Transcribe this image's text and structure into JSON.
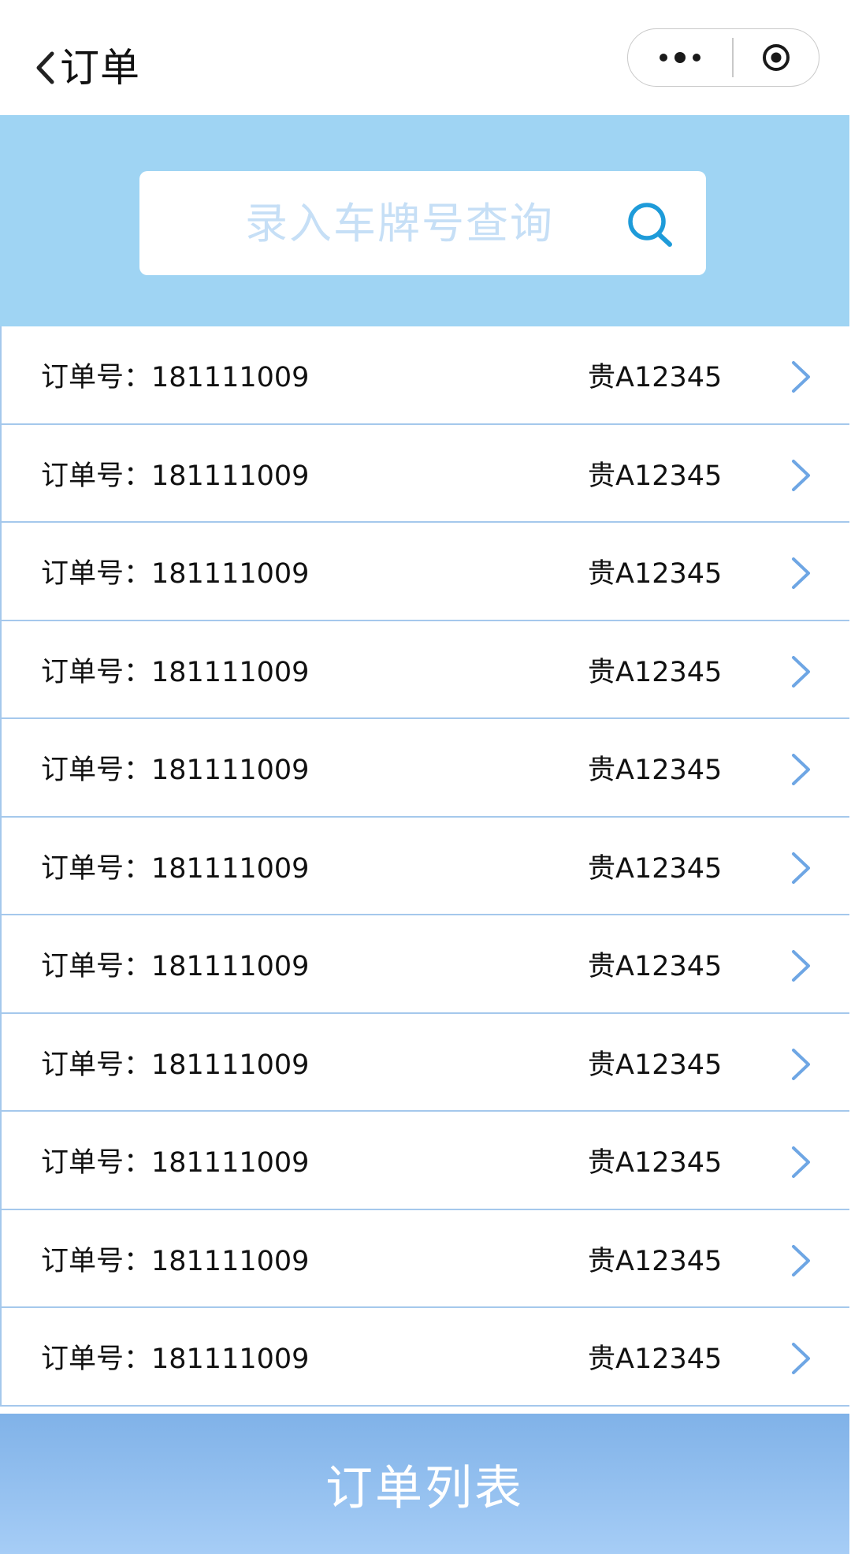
{
  "header": {
    "title": "订单",
    "back_icon": "chevron-left-icon",
    "menu_icon": "more-dots-icon",
    "close_icon": "target-circle-icon"
  },
  "search": {
    "placeholder": "录入车牌号查询",
    "icon": "search-icon",
    "icon_color": "#1e9bd9",
    "band_color": "#9fd4f3"
  },
  "orders": [
    {
      "label": "订单号：181111009",
      "plate": "贵A12345"
    },
    {
      "label": "订单号：181111009",
      "plate": "贵A12345"
    },
    {
      "label": "订单号：181111009",
      "plate": "贵A12345"
    },
    {
      "label": "订单号：181111009",
      "plate": "贵A12345"
    },
    {
      "label": "订单号：181111009",
      "plate": "贵A12345"
    },
    {
      "label": "订单号：181111009",
      "plate": "贵A12345"
    },
    {
      "label": "订单号：181111009",
      "plate": "贵A12345"
    },
    {
      "label": "订单号：181111009",
      "plate": "贵A12345"
    },
    {
      "label": "订单号：181111009",
      "plate": "贵A12345"
    },
    {
      "label": "订单号：181111009",
      "plate": "贵A12345"
    },
    {
      "label": "订单号：181111009",
      "plate": "贵A12345"
    }
  ],
  "row_chevron_icon": "chevron-right-icon",
  "row_chevron_color": "#6ea6e4",
  "footer": {
    "label": "订单列表"
  }
}
